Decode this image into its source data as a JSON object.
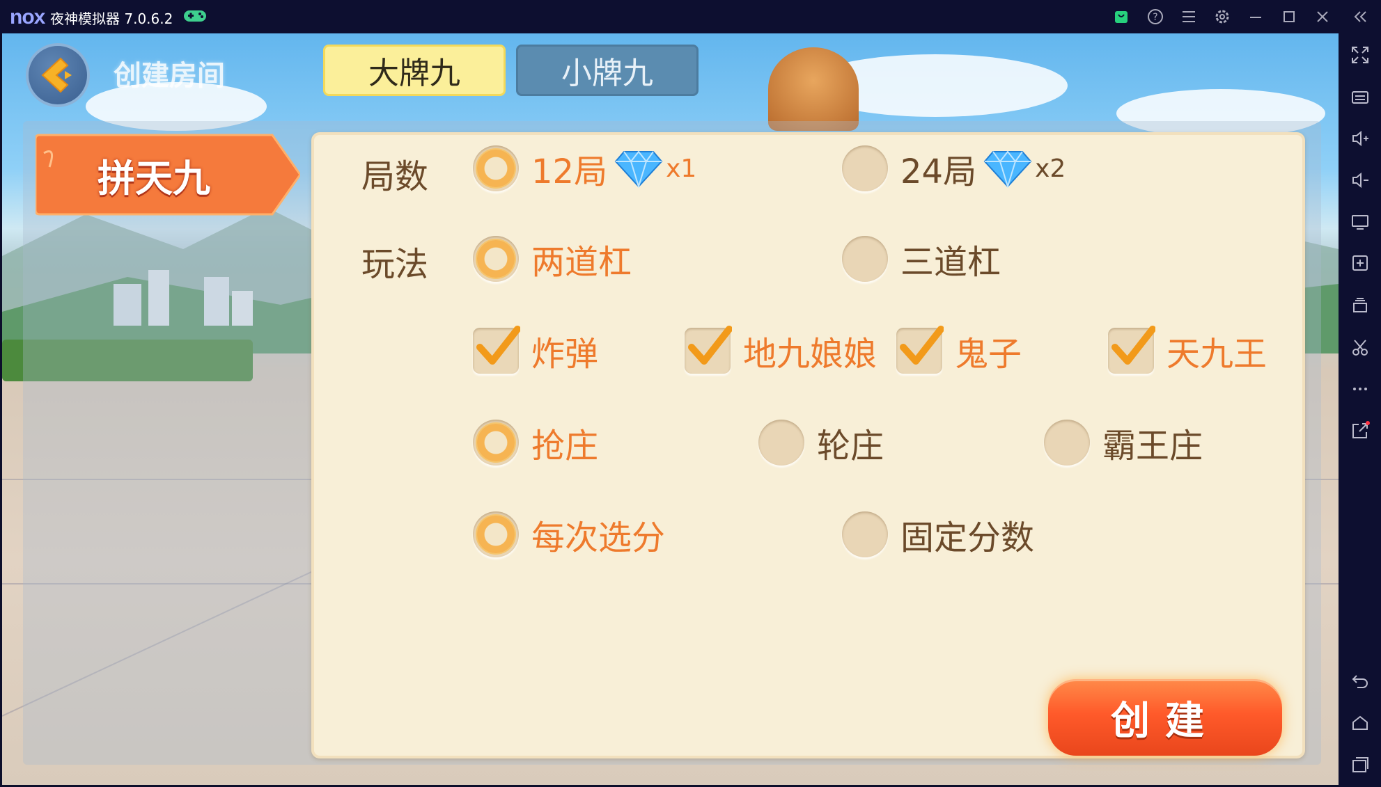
{
  "emulator": {
    "logo": "nox",
    "title": "夜神模拟器 7.0.6.2",
    "titlebar_icons": [
      "gamepad-icon",
      "bag-icon",
      "help-icon",
      "menu-icon",
      "settings-icon",
      "minimize-icon",
      "maximize-icon",
      "close-icon",
      "collapse-icon"
    ],
    "sidebar_icons": [
      "fullscreen-icon",
      "keyboard-icon",
      "volume-up-icon",
      "volume-down-icon",
      "screen-icon",
      "apk-install-icon",
      "multi-instance-icon",
      "scissors-icon",
      "more-icon",
      "share-icon",
      "back-icon",
      "home-icon",
      "recents-icon"
    ]
  },
  "header": {
    "title": "创建房间",
    "tabs": [
      {
        "label": "大牌九",
        "active": true
      },
      {
        "label": "小牌九",
        "active": false
      }
    ]
  },
  "game_type": {
    "label": "拼天九"
  },
  "options": {
    "rounds": {
      "label": "局数",
      "choices": [
        {
          "label": "12局",
          "multiplier": "x1",
          "selected": true
        },
        {
          "label": "24局",
          "multiplier": "x2",
          "selected": false
        }
      ]
    },
    "mode": {
      "label": "玩法",
      "choices": [
        {
          "label": "两道杠",
          "selected": true
        },
        {
          "label": "三道杠",
          "selected": false
        }
      ]
    },
    "extras": [
      {
        "label": "炸弹",
        "checked": true
      },
      {
        "label": "地九娘娘",
        "checked": true
      },
      {
        "label": "鬼子",
        "checked": true
      },
      {
        "label": "天九王",
        "checked": true
      }
    ],
    "banker": [
      {
        "label": "抢庄",
        "selected": true
      },
      {
        "label": "轮庄",
        "selected": false
      },
      {
        "label": "霸王庄",
        "selected": false
      }
    ],
    "scoring": [
      {
        "label": "每次选分",
        "selected": true
      },
      {
        "label": "固定分数",
        "selected": false
      }
    ]
  },
  "create_button": {
    "label": "创建"
  },
  "colors": {
    "accent": "#ee7a2c",
    "text_brown": "#6b4a2a",
    "panel": "#f8efd7",
    "tab_active": "#fbef9a",
    "tab_inactive": "#5b8cb0"
  }
}
